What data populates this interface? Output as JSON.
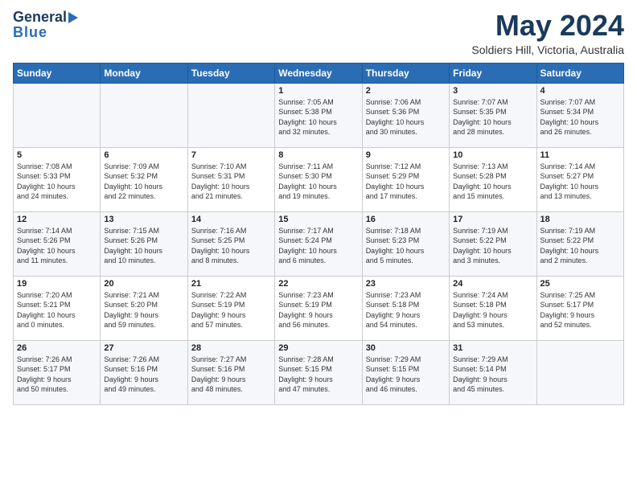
{
  "header": {
    "logo_line1": "General",
    "logo_line2": "Blue",
    "month_title": "May 2024",
    "location": "Soldiers Hill, Victoria, Australia"
  },
  "days_of_week": [
    "Sunday",
    "Monday",
    "Tuesday",
    "Wednesday",
    "Thursday",
    "Friday",
    "Saturday"
  ],
  "weeks": [
    [
      {
        "day": "",
        "info": ""
      },
      {
        "day": "",
        "info": ""
      },
      {
        "day": "",
        "info": ""
      },
      {
        "day": "1",
        "info": "Sunrise: 7:05 AM\nSunset: 5:38 PM\nDaylight: 10 hours\nand 32 minutes."
      },
      {
        "day": "2",
        "info": "Sunrise: 7:06 AM\nSunset: 5:36 PM\nDaylight: 10 hours\nand 30 minutes."
      },
      {
        "day": "3",
        "info": "Sunrise: 7:07 AM\nSunset: 5:35 PM\nDaylight: 10 hours\nand 28 minutes."
      },
      {
        "day": "4",
        "info": "Sunrise: 7:07 AM\nSunset: 5:34 PM\nDaylight: 10 hours\nand 26 minutes."
      }
    ],
    [
      {
        "day": "5",
        "info": "Sunrise: 7:08 AM\nSunset: 5:33 PM\nDaylight: 10 hours\nand 24 minutes."
      },
      {
        "day": "6",
        "info": "Sunrise: 7:09 AM\nSunset: 5:32 PM\nDaylight: 10 hours\nand 22 minutes."
      },
      {
        "day": "7",
        "info": "Sunrise: 7:10 AM\nSunset: 5:31 PM\nDaylight: 10 hours\nand 21 minutes."
      },
      {
        "day": "8",
        "info": "Sunrise: 7:11 AM\nSunset: 5:30 PM\nDaylight: 10 hours\nand 19 minutes."
      },
      {
        "day": "9",
        "info": "Sunrise: 7:12 AM\nSunset: 5:29 PM\nDaylight: 10 hours\nand 17 minutes."
      },
      {
        "day": "10",
        "info": "Sunrise: 7:13 AM\nSunset: 5:28 PM\nDaylight: 10 hours\nand 15 minutes."
      },
      {
        "day": "11",
        "info": "Sunrise: 7:14 AM\nSunset: 5:27 PM\nDaylight: 10 hours\nand 13 minutes."
      }
    ],
    [
      {
        "day": "12",
        "info": "Sunrise: 7:14 AM\nSunset: 5:26 PM\nDaylight: 10 hours\nand 11 minutes."
      },
      {
        "day": "13",
        "info": "Sunrise: 7:15 AM\nSunset: 5:26 PM\nDaylight: 10 hours\nand 10 minutes."
      },
      {
        "day": "14",
        "info": "Sunrise: 7:16 AM\nSunset: 5:25 PM\nDaylight: 10 hours\nand 8 minutes."
      },
      {
        "day": "15",
        "info": "Sunrise: 7:17 AM\nSunset: 5:24 PM\nDaylight: 10 hours\nand 6 minutes."
      },
      {
        "day": "16",
        "info": "Sunrise: 7:18 AM\nSunset: 5:23 PM\nDaylight: 10 hours\nand 5 minutes."
      },
      {
        "day": "17",
        "info": "Sunrise: 7:19 AM\nSunset: 5:22 PM\nDaylight: 10 hours\nand 3 minutes."
      },
      {
        "day": "18",
        "info": "Sunrise: 7:19 AM\nSunset: 5:22 PM\nDaylight: 10 hours\nand 2 minutes."
      }
    ],
    [
      {
        "day": "19",
        "info": "Sunrise: 7:20 AM\nSunset: 5:21 PM\nDaylight: 10 hours\nand 0 minutes."
      },
      {
        "day": "20",
        "info": "Sunrise: 7:21 AM\nSunset: 5:20 PM\nDaylight: 9 hours\nand 59 minutes."
      },
      {
        "day": "21",
        "info": "Sunrise: 7:22 AM\nSunset: 5:19 PM\nDaylight: 9 hours\nand 57 minutes."
      },
      {
        "day": "22",
        "info": "Sunrise: 7:23 AM\nSunset: 5:19 PM\nDaylight: 9 hours\nand 56 minutes."
      },
      {
        "day": "23",
        "info": "Sunrise: 7:23 AM\nSunset: 5:18 PM\nDaylight: 9 hours\nand 54 minutes."
      },
      {
        "day": "24",
        "info": "Sunrise: 7:24 AM\nSunset: 5:18 PM\nDaylight: 9 hours\nand 53 minutes."
      },
      {
        "day": "25",
        "info": "Sunrise: 7:25 AM\nSunset: 5:17 PM\nDaylight: 9 hours\nand 52 minutes."
      }
    ],
    [
      {
        "day": "26",
        "info": "Sunrise: 7:26 AM\nSunset: 5:17 PM\nDaylight: 9 hours\nand 50 minutes."
      },
      {
        "day": "27",
        "info": "Sunrise: 7:26 AM\nSunset: 5:16 PM\nDaylight: 9 hours\nand 49 minutes."
      },
      {
        "day": "28",
        "info": "Sunrise: 7:27 AM\nSunset: 5:16 PM\nDaylight: 9 hours\nand 48 minutes."
      },
      {
        "day": "29",
        "info": "Sunrise: 7:28 AM\nSunset: 5:15 PM\nDaylight: 9 hours\nand 47 minutes."
      },
      {
        "day": "30",
        "info": "Sunrise: 7:29 AM\nSunset: 5:15 PM\nDaylight: 9 hours\nand 46 minutes."
      },
      {
        "day": "31",
        "info": "Sunrise: 7:29 AM\nSunset: 5:14 PM\nDaylight: 9 hours\nand 45 minutes."
      },
      {
        "day": "",
        "info": ""
      }
    ]
  ]
}
